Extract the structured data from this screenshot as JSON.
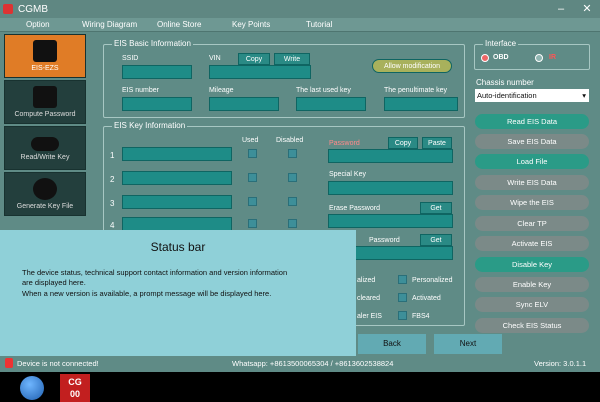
{
  "window": {
    "title": "CGMB",
    "minimize": "–",
    "close": "✕"
  },
  "menu": [
    "Option",
    "Wiring Diagram",
    "Online Store",
    "Key Points",
    "Tutorial"
  ],
  "sidebar": [
    {
      "label": "EIS-EZS"
    },
    {
      "label": "Compute Password"
    },
    {
      "label": "Read/Write Key"
    },
    {
      "label": "Generate Key File"
    }
  ],
  "eis_basic": {
    "title": "EIS Basic Information",
    "ssid_label": "SSID",
    "vin_label": "VIN",
    "copy_label": "Copy",
    "write_label": "Write",
    "allow_mod_label": "Allow modification",
    "eis_number_label": "EIS number",
    "mileage_label": "Mileage",
    "last_used_key_label": "The last used key",
    "penultimate_key_label": "The penultimate key"
  },
  "interface": {
    "title": "Interface",
    "obd": "OBD",
    "ir": "IR"
  },
  "chassis": {
    "label": "Chassis number",
    "value": "Auto-identification"
  },
  "eis_key": {
    "title": "EIS Key Information",
    "used": "Used",
    "disabled": "Disabled",
    "rows": [
      "1",
      "2",
      "3",
      "4"
    ],
    "password_label": "Password",
    "copy_label": "Copy",
    "paste_label": "Paste",
    "special_key_label": "Special Key",
    "erase_password_label": "Erase Password",
    "get_label": "Get",
    "password2_label": "Password",
    "get2_label": "Get"
  },
  "status_checks": {
    "alized": "alized",
    "personalized": "Personalized",
    "cleared": "cleared",
    "activated": "Activated",
    "aler_eis": "aler EIS",
    "fbs4": "FBS4"
  },
  "actions": [
    "Read EIS Data",
    "Save EIS Data",
    "Load File",
    "Write EIS Data",
    "Wipe the EIS",
    "Clear TP",
    "Activate EIS",
    "Disable Key",
    "Enable Key",
    "Sync ELV",
    "Check EIS Status"
  ],
  "nav": {
    "back": "Back",
    "next": "Next"
  },
  "statusbar": {
    "device": "Device is not connected!",
    "contact": "Whatsapp: +8613500065304 / +8613602538824",
    "version": "Version: 3.0.1.1"
  },
  "overlay": {
    "title": "Status bar",
    "line1": "The device status, technical support contact information and version information",
    "line2": "are displayed here.",
    "line3": "When a new version is available, a prompt message will be displayed here."
  },
  "taskbar": {
    "app_label_top": "CG",
    "app_label_bottom": "00"
  }
}
